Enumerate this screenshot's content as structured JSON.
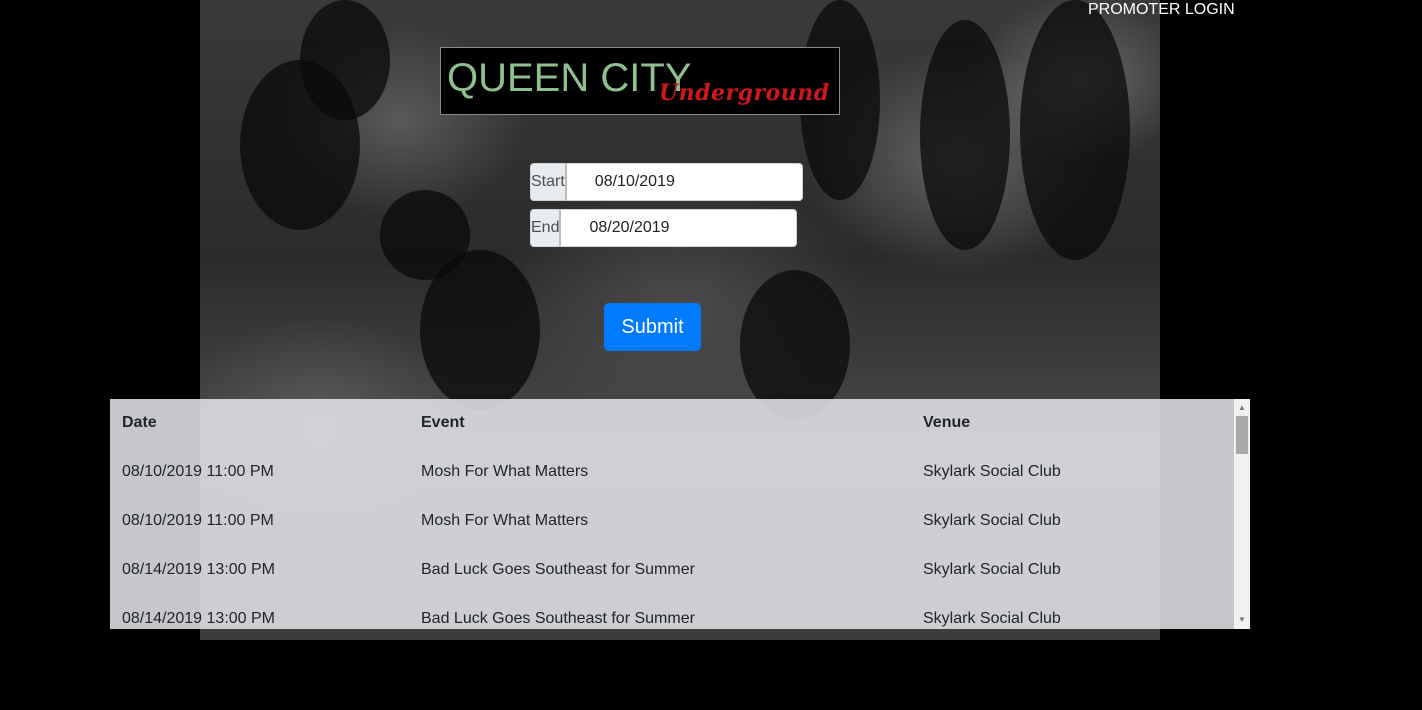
{
  "header": {
    "promoter_login": "PROMOTER LOGIN"
  },
  "logo": {
    "main": "QUEEN CITY",
    "sub": "Underground"
  },
  "search": {
    "start_label": "Start",
    "start_value": "08/10/2019",
    "end_label": "End",
    "end_value": "08/20/2019",
    "submit_label": "Submit"
  },
  "events": {
    "columns": [
      "Date",
      "Event",
      "Venue"
    ],
    "rows": [
      {
        "date": "08/10/2019 11:00 PM",
        "event": "Mosh For What Matters",
        "venue": "Skylark Social Club"
      },
      {
        "date": "08/10/2019 11:00 PM",
        "event": "Mosh For What Matters",
        "venue": "Skylark Social Club"
      },
      {
        "date": "08/14/2019 13:00 PM",
        "event": "Bad Luck Goes Southeast for Summer",
        "venue": "Skylark Social Club"
      },
      {
        "date": "08/14/2019 13:00 PM",
        "event": "Bad Luck Goes Southeast for Summer",
        "venue": "Skylark Social Club"
      }
    ]
  },
  "colors": {
    "accent": "#007bff",
    "logo_main": "#8fbf8f",
    "logo_sub": "#d01818"
  },
  "icons": {
    "scroll_up": "scroll-up-arrow-icon",
    "scroll_down": "scroll-down-arrow-icon"
  }
}
